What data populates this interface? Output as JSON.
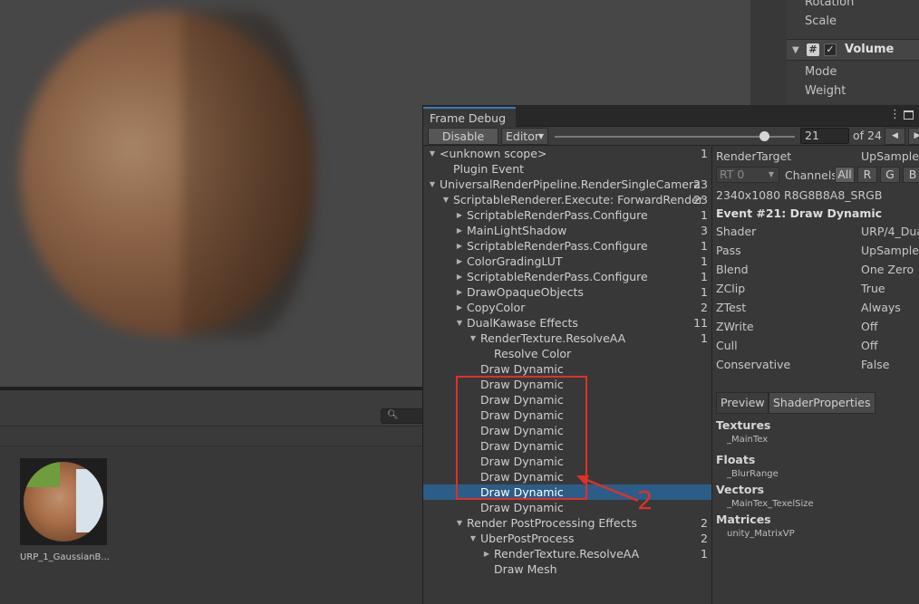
{
  "inspector": {
    "rotation": "Rotation",
    "scale": "Scale",
    "volume_component": "Volume",
    "volume_checked": true,
    "mode": "Mode",
    "weight": "Weight"
  },
  "project": {
    "asset_label": "URP_1_GaussianB..."
  },
  "frame_debug": {
    "tab_title": "Frame Debug",
    "disable_label": "Disable",
    "editor_label": "Editor",
    "current_event": "21",
    "of_label": "of 24",
    "slider_fraction": 0.875,
    "tree": [
      {
        "label": "<unknown scope>",
        "count": "1",
        "indent": 0,
        "arrow": "down"
      },
      {
        "label": "Plugin Event",
        "count": "",
        "indent": 1,
        "arrow": ""
      },
      {
        "label": "UniversalRenderPipeline.RenderSingleCamera",
        "count": "23",
        "indent": 0,
        "arrow": "down"
      },
      {
        "label": "ScriptableRenderer.Execute: ForwardRender",
        "count": "23",
        "indent": 1,
        "arrow": "down"
      },
      {
        "label": "ScriptableRenderPass.Configure",
        "count": "1",
        "indent": 2,
        "arrow": "right"
      },
      {
        "label": "MainLightShadow",
        "count": "3",
        "indent": 2,
        "arrow": "right"
      },
      {
        "label": "ScriptableRenderPass.Configure",
        "count": "1",
        "indent": 2,
        "arrow": "right"
      },
      {
        "label": "ColorGradingLUT",
        "count": "1",
        "indent": 2,
        "arrow": "right"
      },
      {
        "label": "ScriptableRenderPass.Configure",
        "count": "1",
        "indent": 2,
        "arrow": "right"
      },
      {
        "label": "DrawOpaqueObjects",
        "count": "1",
        "indent": 2,
        "arrow": "right"
      },
      {
        "label": "CopyColor",
        "count": "2",
        "indent": 2,
        "arrow": "right"
      },
      {
        "label": "DualKawase Effects",
        "count": "11",
        "indent": 2,
        "arrow": "down"
      },
      {
        "label": "RenderTexture.ResolveAA",
        "count": "1",
        "indent": 3,
        "arrow": "down"
      },
      {
        "label": "Resolve Color",
        "count": "",
        "indent": 4,
        "arrow": ""
      },
      {
        "label": "Draw Dynamic",
        "count": "",
        "indent": 3,
        "arrow": ""
      },
      {
        "label": "Draw Dynamic",
        "count": "",
        "indent": 3,
        "arrow": ""
      },
      {
        "label": "Draw Dynamic",
        "count": "",
        "indent": 3,
        "arrow": ""
      },
      {
        "label": "Draw Dynamic",
        "count": "",
        "indent": 3,
        "arrow": ""
      },
      {
        "label": "Draw Dynamic",
        "count": "",
        "indent": 3,
        "arrow": ""
      },
      {
        "label": "Draw Dynamic",
        "count": "",
        "indent": 3,
        "arrow": ""
      },
      {
        "label": "Draw Dynamic",
        "count": "",
        "indent": 3,
        "arrow": ""
      },
      {
        "label": "Draw Dynamic",
        "count": "",
        "indent": 3,
        "arrow": ""
      },
      {
        "label": "Draw Dynamic",
        "count": "",
        "indent": 3,
        "arrow": "",
        "selected": true
      },
      {
        "label": "Draw Dynamic",
        "count": "",
        "indent": 3,
        "arrow": ""
      },
      {
        "label": "Render PostProcessing Effects",
        "count": "2",
        "indent": 2,
        "arrow": "down"
      },
      {
        "label": "UberPostProcess",
        "count": "2",
        "indent": 3,
        "arrow": "down"
      },
      {
        "label": "RenderTexture.ResolveAA",
        "count": "1",
        "indent": 4,
        "arrow": "right"
      },
      {
        "label": "Draw Mesh",
        "count": "",
        "indent": 4,
        "arrow": ""
      }
    ],
    "details": {
      "render_target_key": "RenderTarget",
      "render_target_val": "UpSampleC",
      "rt_label": "RT 0",
      "channels_label": "Channels",
      "channels": [
        "All",
        "R",
        "G",
        "B"
      ],
      "active_channel": "All",
      "resolution": "2340x1080 R8G8B8A8_SRGB",
      "event_title": "Event #21: Draw Dynamic",
      "props": [
        {
          "key": "Shader",
          "value": "URP/4_Dua"
        },
        {
          "key": "Pass",
          "value": "UpSample"
        },
        {
          "key": "Blend",
          "value": "One Zero"
        },
        {
          "key": "ZClip",
          "value": "True"
        },
        {
          "key": "ZTest",
          "value": "Always"
        },
        {
          "key": "ZWrite",
          "value": "Off"
        },
        {
          "key": "Cull",
          "value": "Off"
        },
        {
          "key": "Conservative",
          "value": "False"
        }
      ],
      "tabs": [
        "Preview",
        "ShaderProperties"
      ],
      "active_tab": "ShaderProperties",
      "textures_head": "Textures",
      "textures": [
        "_MainTex"
      ],
      "floats_head": "Floats",
      "floats": [
        "_BlurRange"
      ],
      "vectors_head": "Vectors",
      "vectors": [
        "_MainTex_TexelSize"
      ],
      "matrices_head": "Matrices",
      "matrices": [
        "unity_MatrixVP"
      ]
    }
  },
  "annotation": {
    "number": "2",
    "color": "#e0302a"
  },
  "colors": {
    "selection": "#2c5d87",
    "tab_accent": "#3a79bb",
    "panel": "#383838"
  }
}
